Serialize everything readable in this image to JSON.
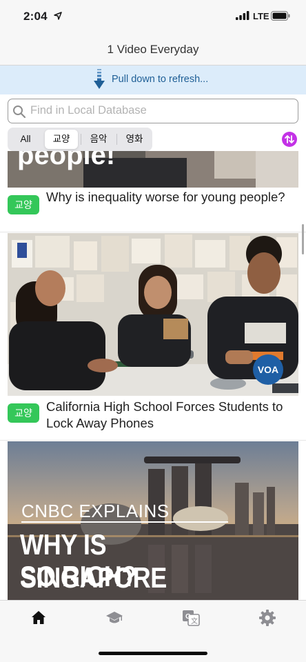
{
  "status_bar": {
    "time": "2:04",
    "network": "LTE"
  },
  "nav": {
    "title": "1 Video Everyday"
  },
  "refresh": {
    "text": "Pull down to refresh..."
  },
  "search": {
    "placeholder": "Find in Local Database",
    "value": ""
  },
  "segments": {
    "items": [
      "All",
      "교양",
      "음악",
      "영화"
    ],
    "selected": "교양"
  },
  "list": {
    "items": [
      {
        "thumb_text": "people!",
        "tag": "교양",
        "title": "Why is inequality worse for young people?"
      },
      {
        "thumb_text": "VOA",
        "tag": "교양",
        "title": "California High School Forces Students to Lock Away Phones"
      },
      {
        "thumb_text_1": "CNBC EXPLAINS",
        "thumb_text_2": "WHY IS SINGAPORE",
        "thumb_text_3": "SO RICH?"
      }
    ]
  },
  "tabs": [
    {
      "icon": "home-icon",
      "active": true
    },
    {
      "icon": "graduation-cap-icon",
      "active": false
    },
    {
      "icon": "translate-icon",
      "active": false
    },
    {
      "icon": "gear-icon",
      "active": false
    }
  ],
  "colors": {
    "tag_green": "#34c759",
    "sort_purple": "#c332e6",
    "refresh_bg": "#dcecfa",
    "refresh_text": "#1f5f96"
  }
}
